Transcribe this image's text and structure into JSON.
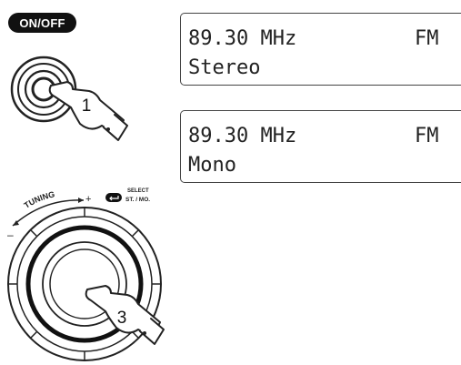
{
  "power": {
    "label": "ON/OFF",
    "step": "1"
  },
  "display_stereo": {
    "frequency": "89.30 MHz",
    "band": "FM",
    "mode": "Stereo"
  },
  "display_mono": {
    "frequency": "89.30 MHz",
    "band": "FM",
    "mode": "Mono"
  },
  "tuning_knob": {
    "tuning_label": "TUNING",
    "minus": "–",
    "plus": "+",
    "select_label": "SELECT",
    "stmo_label": "ST. / MO.",
    "step": "3"
  }
}
